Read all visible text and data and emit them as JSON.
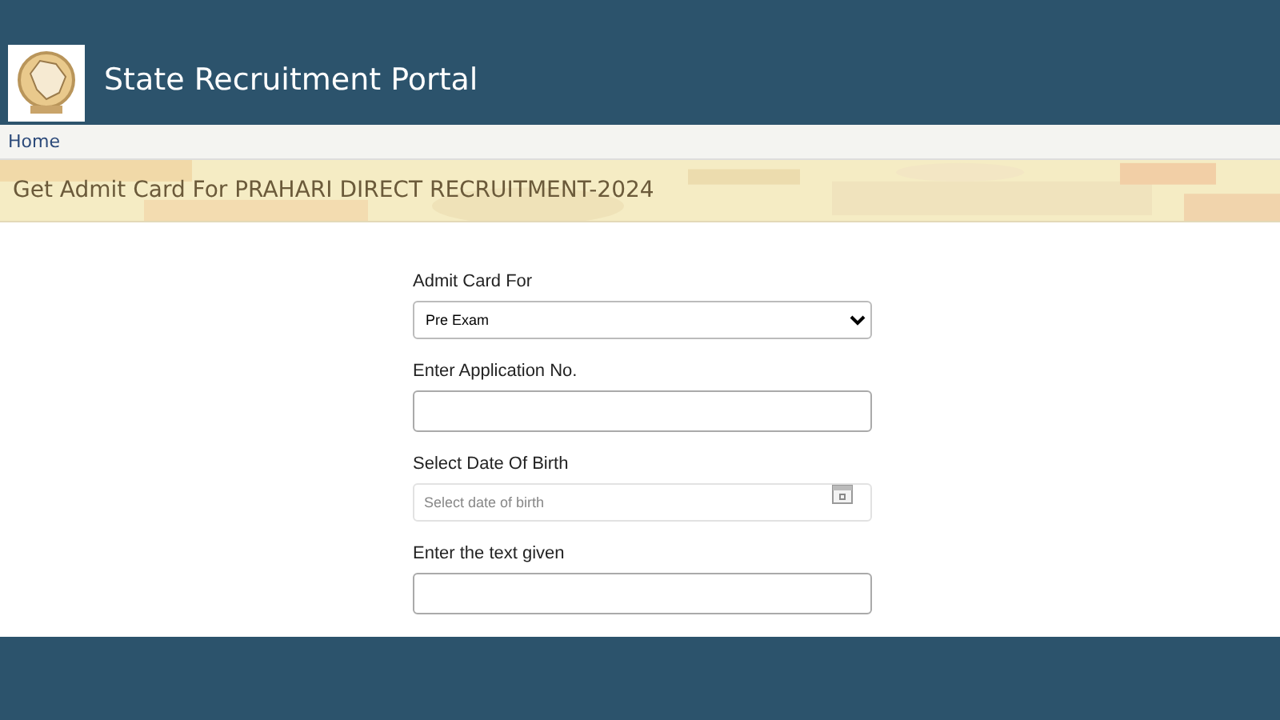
{
  "header": {
    "title": "State Recruitment Portal"
  },
  "nav": {
    "items": [
      {
        "label": "Home"
      }
    ]
  },
  "banner": {
    "title": "Get Admit Card For PRAHARI DIRECT RECRUITMENT-2024"
  },
  "form": {
    "fields": [
      {
        "kind": "select",
        "label": "Admit Card For",
        "value": "Pre Exam"
      },
      {
        "kind": "text",
        "label": "Enter Application No."
      },
      {
        "kind": "date",
        "label": "Select Date Of Birth",
        "placeholder": "Select date of birth"
      },
      {
        "kind": "text",
        "label": "Enter the text given"
      }
    ]
  }
}
